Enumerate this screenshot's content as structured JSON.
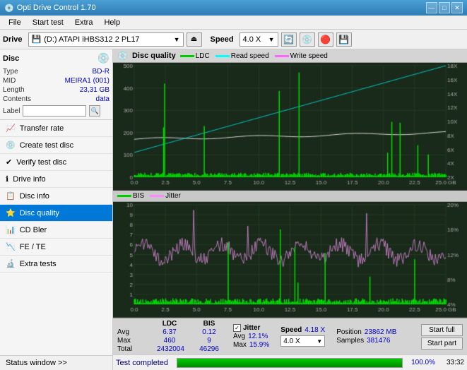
{
  "app": {
    "title": "Opti Drive Control 1.70",
    "icon": "💿"
  },
  "titlebar": {
    "title": "Opti Drive Control 1.70",
    "minimize": "—",
    "maximize": "□",
    "close": "✕"
  },
  "menubar": {
    "items": [
      "File",
      "Start test",
      "Extra",
      "Help"
    ]
  },
  "drivebar": {
    "label": "Drive",
    "drive_name": "(D:) ATAPI iHBS312  2 PL17",
    "speed_label": "Speed",
    "speed_value": "4.0 X",
    "eject_icon": "⏏"
  },
  "disc": {
    "title": "Disc",
    "type_label": "Type",
    "type_value": "BD-R",
    "mid_label": "MID",
    "mid_value": "MEIRA1 (001)",
    "length_label": "Length",
    "length_value": "23,31 GB",
    "contents_label": "Contents",
    "contents_value": "data",
    "label_label": "Label",
    "label_value": ""
  },
  "nav": {
    "items": [
      {
        "id": "transfer-rate",
        "label": "Transfer rate",
        "icon": "📈"
      },
      {
        "id": "create-test-disc",
        "label": "Create test disc",
        "icon": "💿"
      },
      {
        "id": "verify-test-disc",
        "label": "Verify test disc",
        "icon": "✔"
      },
      {
        "id": "drive-info",
        "label": "Drive info",
        "icon": "ℹ"
      },
      {
        "id": "disc-info",
        "label": "Disc info",
        "icon": "📋"
      },
      {
        "id": "disc-quality",
        "label": "Disc quality",
        "icon": "⭐",
        "active": true
      },
      {
        "id": "cd-bler",
        "label": "CD Bler",
        "icon": "📊"
      },
      {
        "id": "fe-te",
        "label": "FE / TE",
        "icon": "📉"
      },
      {
        "id": "extra-tests",
        "label": "Extra tests",
        "icon": "🔬"
      }
    ]
  },
  "status_window": "Status window >>",
  "quality": {
    "title": "Disc quality",
    "legend": {
      "ldc": "LDC",
      "read_speed": "Read speed",
      "write_speed": "Write speed",
      "bis": "BIS",
      "jitter": "Jitter"
    }
  },
  "stats": {
    "columns": [
      "LDC",
      "BIS"
    ],
    "rows": [
      {
        "label": "Avg",
        "ldc": "6.37",
        "bis": "0.12"
      },
      {
        "label": "Max",
        "ldc": "460",
        "bis": "9"
      },
      {
        "label": "Total",
        "ldc": "2432004",
        "bis": "46296"
      }
    ],
    "jitter_label": "Jitter",
    "jitter_checked": true,
    "jitter_avg": "12.1%",
    "jitter_max": "15.9%",
    "speed_label": "Speed",
    "speed_value": "4.18 X",
    "speed_select": "4.0 X",
    "position_label": "Position",
    "position_value": "23862 MB",
    "samples_label": "Samples",
    "samples_value": "381476",
    "start_full": "Start full",
    "start_part": "Start part"
  },
  "progress": {
    "status": "Test completed",
    "percent": "100.0%",
    "fill": 100,
    "time": "33:32"
  },
  "chart1": {
    "y_max": 500,
    "y_labels_left": [
      "500",
      "400",
      "300",
      "200",
      "100",
      "0"
    ],
    "y_labels_right": [
      "18X",
      "16X",
      "14X",
      "12X",
      "10X",
      "8X",
      "6X",
      "4X",
      "2X"
    ],
    "x_labels": [
      "0.0",
      "2.5",
      "5.0",
      "7.5",
      "10.0",
      "12.5",
      "15.0",
      "17.5",
      "20.0",
      "22.5",
      "25.0 GB"
    ]
  },
  "chart2": {
    "y_max": 10,
    "y_labels_left": [
      "10",
      "9",
      "8",
      "7",
      "6",
      "5",
      "4",
      "3",
      "2",
      "1"
    ],
    "y_labels_right": [
      "20%",
      "16%",
      "12%",
      "8%",
      "4%"
    ],
    "x_labels": [
      "0.0",
      "2.5",
      "5.0",
      "7.5",
      "10.0",
      "12.5",
      "15.0",
      "17.5",
      "20.0",
      "22.5",
      "25.0 GB"
    ]
  },
  "colors": {
    "ldc": "#22dd22",
    "read_speed": "#00ffff",
    "write_speed": "#ff66ff",
    "bis": "#22dd22",
    "jitter": "#ff88ff",
    "chart_bg": "#1e2a1e",
    "grid": "#2a3e2a",
    "active_nav": "#0078d7"
  }
}
